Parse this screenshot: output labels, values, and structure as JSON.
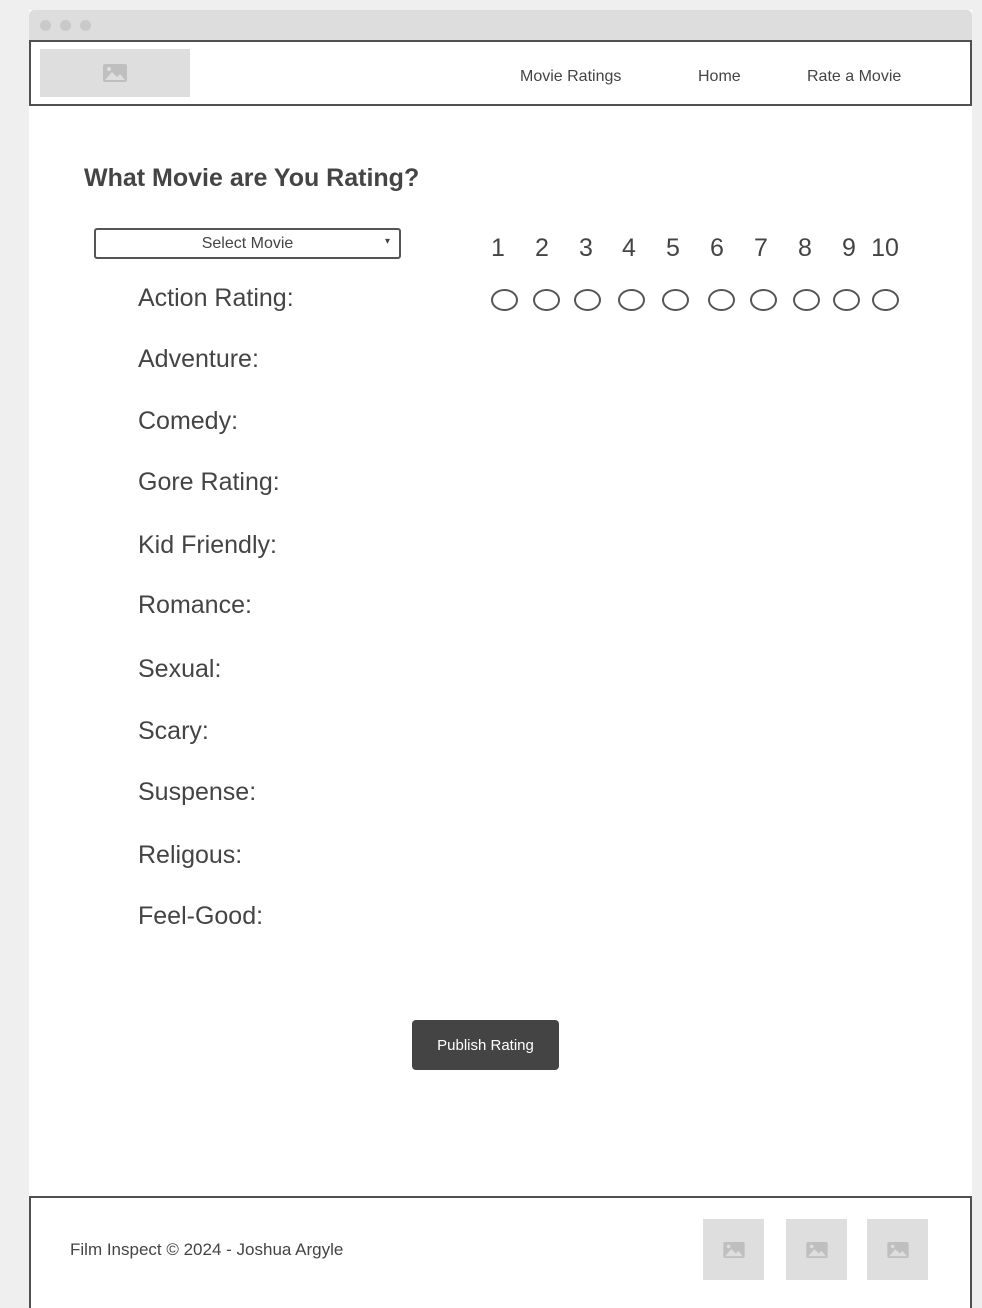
{
  "window": {
    "icons": [
      "dot",
      "dot",
      "dot"
    ]
  },
  "navbar": {
    "logo_icon": "image-icon",
    "links": [
      "Movie Ratings",
      "Home",
      "Rate a Movie"
    ]
  },
  "main": {
    "heading": "What Movie are You Rating?",
    "select": {
      "selected": "Select Movie",
      "caret": "▾"
    },
    "scale": [
      "1",
      "2",
      "3",
      "4",
      "5",
      "6",
      "7",
      "8",
      "9",
      "10"
    ],
    "categories": [
      "Action Rating:",
      "Adventure:",
      "Comedy:",
      "Gore Rating:",
      "Kid Friendly:",
      "Romance:",
      "Sexual:",
      "Scary:",
      "Suspense:",
      "Religous:",
      "Feel-Good:"
    ],
    "publish_label": "Publish Rating"
  },
  "footer": {
    "text": "Film Inspect © 2024 - Joshua Argyle",
    "icons": [
      "image-icon",
      "image-icon",
      "image-icon"
    ]
  },
  "colors": {
    "dark": "#444444",
    "placeholder": "#dedede",
    "border": "#505050"
  }
}
